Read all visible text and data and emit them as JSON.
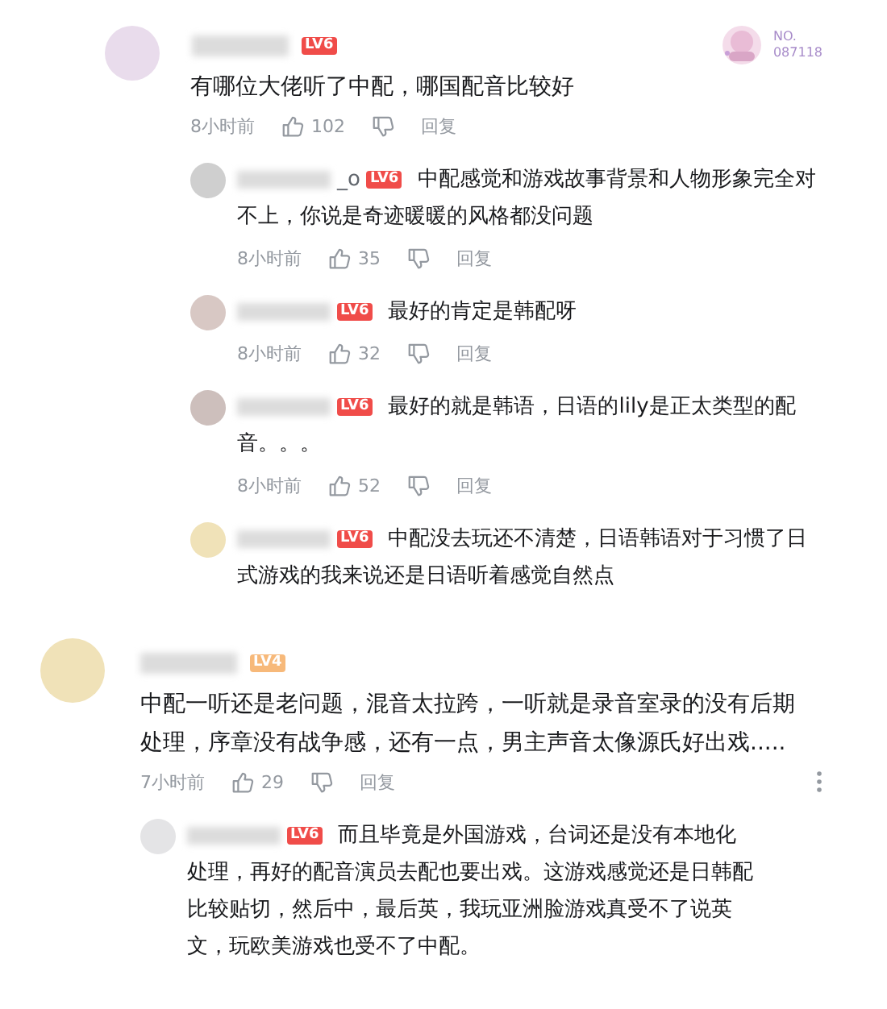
{
  "comments": [
    {
      "badge": {
        "label": "LV6",
        "color": "#f04c49"
      },
      "fan_badge": {
        "label": "NO.",
        "number": "087118"
      },
      "lines": [
        "有哪位大佬听了中配，哪国配音比较好"
      ],
      "time": "8小时前",
      "likes": "102",
      "reply_label": "回复",
      "replies": [
        {
          "name_tail": "_o",
          "badge": {
            "label": "LV6",
            "color": "#f04c49"
          },
          "lines": [
            "中配感觉和游戏故事背景和人物形象完全对",
            "不上，你说是奇迹暖暖的风格都没问题"
          ],
          "time": "8小时前",
          "likes": "35",
          "reply_label": "回复"
        },
        {
          "badge": {
            "label": "LV6",
            "color": "#f04c49"
          },
          "lines": [
            "最好的肯定是韩配呀"
          ],
          "time": "8小时前",
          "likes": "32",
          "reply_label": "回复"
        },
        {
          "badge": {
            "label": "LV6",
            "color": "#f04c49"
          },
          "lines": [
            "最好的就是韩语，日语的lily是正太类型的配",
            "音。。。"
          ],
          "time": "8小时前",
          "likes": "52",
          "reply_label": "回复"
        },
        {
          "badge": {
            "label": "LV6",
            "color": "#f04c49"
          },
          "lines": [
            "中配没去玩还不清楚，日语韩语对于习惯了日",
            "式游戏的我来说还是日语听着感觉自然点"
          ]
        }
      ]
    },
    {
      "badge": {
        "label": "LV4",
        "color": "#f7b97a"
      },
      "lines": [
        "中配一听还是老问题，混音太拉跨，一听就是录音室录的没有后期",
        "处理，序章没有战争感，还有一点，男主声音太像源氏好出戏....."
      ],
      "time": "7小时前",
      "likes": "29",
      "reply_label": "回复",
      "more": true,
      "replies": [
        {
          "badge": {
            "label": "LV6",
            "color": "#f04c49"
          },
          "lines": [
            "而且毕竟是外国游戏，台词还是没有本地化",
            "处理，再好的配音演员去配也要出戏。这游戏感觉还是日韩配",
            "比较贴切，然后中，最后英，我玩亚洲脸游戏真受不了说英",
            "文，玩欧美游戏也受不了中配。"
          ]
        }
      ]
    }
  ]
}
